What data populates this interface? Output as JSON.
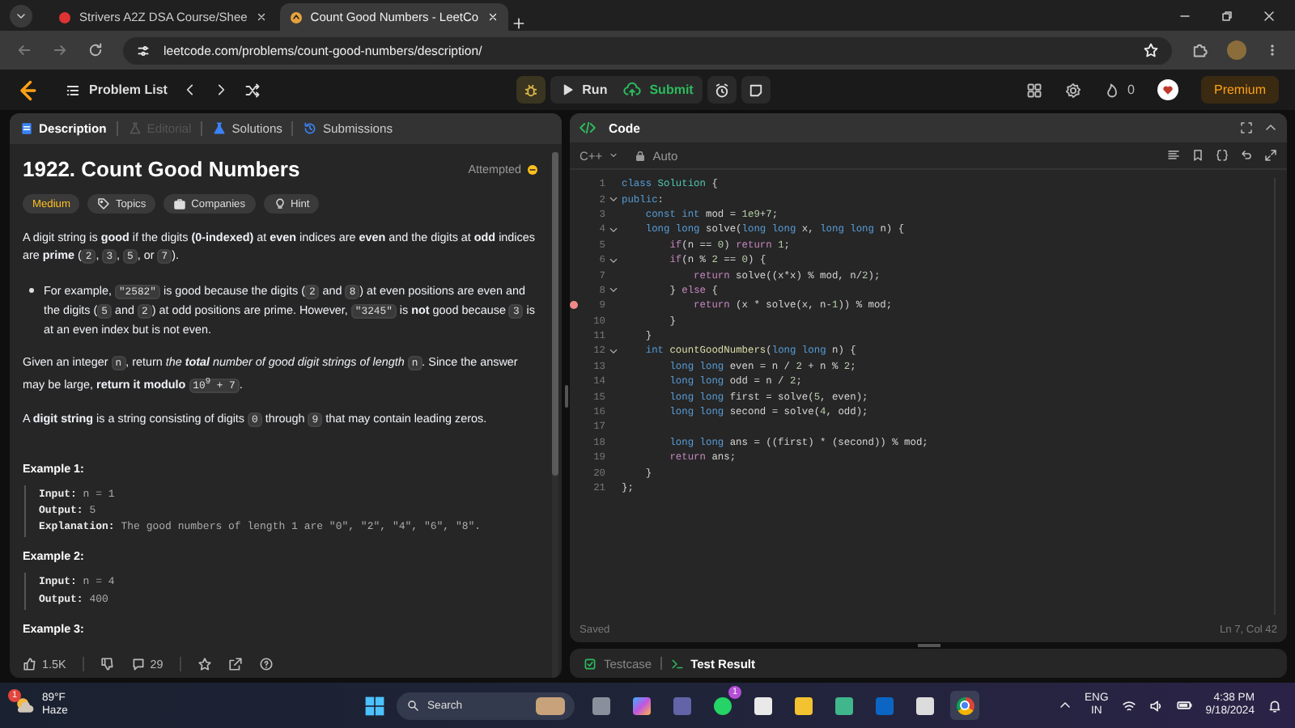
{
  "browser": {
    "tabs": [
      {
        "title": "Strivers A2Z DSA Course/Shee",
        "selected": false
      },
      {
        "title": "Count Good Numbers - LeetCo",
        "selected": true
      }
    ],
    "url": "leetcode.com/problems/count-good-numbers/description/"
  },
  "nav": {
    "problem_list": "Problem List",
    "run": "Run",
    "submit": "Submit",
    "streak": "0",
    "premium": "Premium"
  },
  "description": {
    "tabs": [
      {
        "label": "Description",
        "selected": true,
        "disabled": false
      },
      {
        "label": "Editorial",
        "selected": false,
        "disabled": true
      },
      {
        "label": "Solutions",
        "selected": false,
        "disabled": false
      },
      {
        "label": "Submissions",
        "selected": false,
        "disabled": false
      }
    ],
    "title": "1922. Count Good Numbers",
    "status": "Attempted",
    "tags": [
      {
        "kind": "difficulty",
        "label": "Medium"
      },
      {
        "kind": "topics",
        "label": "Topics"
      },
      {
        "kind": "companies",
        "label": "Companies"
      },
      {
        "kind": "hint",
        "label": "Hint"
      }
    ],
    "paragraphs": [
      {
        "kind": "text",
        "segments": [
          {
            "kind": "text",
            "text": "A digit string is **good** if the digits **(0-indexed)** at **even** indices are **even** and the digits at **odd** indices are **prime** ("
          },
          {
            "kind": "code",
            "text": "2"
          },
          {
            "kind": "text",
            "text": ", "
          },
          {
            "kind": "code",
            "text": "3"
          },
          {
            "kind": "text",
            "text": ", "
          },
          {
            "kind": "code",
            "text": "5"
          },
          {
            "kind": "text",
            "text": ", or "
          },
          {
            "kind": "code",
            "text": "7"
          },
          {
            "kind": "text",
            "text": ")."
          }
        ]
      },
      {
        "kind": "bullet",
        "segments": [
          {
            "kind": "text",
            "text": "For example, "
          },
          {
            "kind": "code",
            "text": "\"2582\""
          },
          {
            "kind": "text",
            "text": " is good because the digits ("
          },
          {
            "kind": "code",
            "text": "2"
          },
          {
            "kind": "text",
            "text": " and "
          },
          {
            "kind": "code",
            "text": "8"
          },
          {
            "kind": "text",
            "text": ") at even positions are even and the digits ("
          },
          {
            "kind": "code",
            "text": "5"
          },
          {
            "kind": "text",
            "text": " and "
          },
          {
            "kind": "code",
            "text": "2"
          },
          {
            "kind": "text",
            "text": ") at odd positions are prime. However, "
          },
          {
            "kind": "code",
            "text": "\"3245\""
          },
          {
            "kind": "text",
            "text": " is **not** good because "
          },
          {
            "kind": "code",
            "text": "3"
          },
          {
            "kind": "text",
            "text": " is at an even index but is not even."
          }
        ]
      },
      {
        "kind": "text",
        "segments": [
          {
            "kind": "text",
            "text": "Given an integer "
          },
          {
            "kind": "code",
            "text": "n"
          },
          {
            "kind": "text",
            "text": ", return "
          },
          {
            "kind": "italic",
            "text": "the **total** number of good digit strings of length "
          },
          {
            "kind": "code",
            "text": "n"
          },
          {
            "kind": "text",
            "text": ". Since the answer may be large, **return it modulo** "
          },
          {
            "kind": "code",
            "text": "10$^{9}$ + 7"
          },
          {
            "kind": "text",
            "text": "."
          }
        ]
      },
      {
        "kind": "text",
        "segments": [
          {
            "kind": "text",
            "text": "A **digit string** is a string consisting of digits "
          },
          {
            "kind": "code",
            "text": "0"
          },
          {
            "kind": "text",
            "text": " through "
          },
          {
            "kind": "code",
            "text": "9"
          },
          {
            "kind": "text",
            "text": " that may contain leading zeros."
          }
        ]
      }
    ],
    "examples": [
      {
        "title": "Example 1:",
        "lines": [
          {
            "label": "Input:",
            "value": "n = 1"
          },
          {
            "label": "Output:",
            "value": "5"
          },
          {
            "label": "Explanation:",
            "value": "The good numbers of length 1 are \"0\", \"2\", \"4\", \"6\", \"8\"."
          }
        ]
      },
      {
        "title": "Example 2:",
        "lines": [
          {
            "label": "Input:",
            "value": "n = 4"
          },
          {
            "label": "Output:",
            "value": "400"
          }
        ]
      },
      {
        "title": "Example 3:"
      }
    ],
    "footer": {
      "likes": "1.5K",
      "comments": "29"
    }
  },
  "editor": {
    "title": "Code",
    "language": "C++",
    "mode": "Auto",
    "lines": [
      {
        "n": "1",
        "fold": false,
        "breakpoint": false,
        "tokens": [
          {
            "kind": "keyword",
            "text": "class "
          },
          {
            "kind": "type",
            "text": "Solution"
          },
          {
            "kind": "plain",
            "text": " {"
          }
        ]
      },
      {
        "n": "2",
        "fold": true,
        "breakpoint": false,
        "tokens": [
          {
            "kind": "keyword",
            "text": "public"
          },
          {
            "kind": "plain",
            "text": ":"
          }
        ]
      },
      {
        "n": "3",
        "fold": false,
        "breakpoint": false,
        "tokens": [
          {
            "kind": "keyword",
            "text": "    const int"
          },
          {
            "kind": "plain",
            "text": " mod = "
          },
          {
            "kind": "number",
            "text": "1e9"
          },
          {
            "kind": "plain",
            "text": "+"
          },
          {
            "kind": "number",
            "text": "7"
          },
          {
            "kind": "plain",
            "text": ";"
          }
        ]
      },
      {
        "n": "4",
        "fold": true,
        "breakpoint": false,
        "tokens": [
          {
            "kind": "keyword",
            "text": "    long long"
          },
          {
            "kind": "plain",
            "text": " solve("
          },
          {
            "kind": "keyword",
            "text": "long long"
          },
          {
            "kind": "plain",
            "text": " x, "
          },
          {
            "kind": "keyword",
            "text": "long long"
          },
          {
            "kind": "plain",
            "text": " n) {"
          }
        ]
      },
      {
        "n": "5",
        "fold": false,
        "breakpoint": false,
        "tokens": [
          {
            "kind": "control",
            "text": "        if"
          },
          {
            "kind": "plain",
            "text": "(n == "
          },
          {
            "kind": "number",
            "text": "0"
          },
          {
            "kind": "plain",
            "text": ") "
          },
          {
            "kind": "control",
            "text": "return "
          },
          {
            "kind": "number",
            "text": "1"
          },
          {
            "kind": "plain",
            "text": ";"
          }
        ]
      },
      {
        "n": "6",
        "fold": true,
        "breakpoint": false,
        "tokens": [
          {
            "kind": "control",
            "text": "        if"
          },
          {
            "kind": "plain",
            "text": "(n % "
          },
          {
            "kind": "number",
            "text": "2"
          },
          {
            "kind": "plain",
            "text": " == "
          },
          {
            "kind": "number",
            "text": "0"
          },
          {
            "kind": "plain",
            "text": ") {"
          }
        ]
      },
      {
        "n": "7",
        "fold": false,
        "breakpoint": false,
        "tokens": [
          {
            "kind": "control",
            "text": "            return"
          },
          {
            "kind": "plain",
            "text": " solve((x*x) % mod, n/"
          },
          {
            "kind": "number",
            "text": "2"
          },
          {
            "kind": "plain",
            "text": ");"
          }
        ]
      },
      {
        "n": "8",
        "fold": true,
        "breakpoint": false,
        "tokens": [
          {
            "kind": "plain",
            "text": "        } "
          },
          {
            "kind": "control",
            "text": "else"
          },
          {
            "kind": "plain",
            "text": " {"
          }
        ]
      },
      {
        "n": "9",
        "fold": false,
        "breakpoint": true,
        "tokens": [
          {
            "kind": "control",
            "text": "            return"
          },
          {
            "kind": "plain",
            "text": " (x * solve(x, n-"
          },
          {
            "kind": "number",
            "text": "1"
          },
          {
            "kind": "plain",
            "text": ")) % mod;"
          }
        ]
      },
      {
        "n": "10",
        "fold": false,
        "breakpoint": false,
        "tokens": [
          {
            "kind": "plain",
            "text": "        }"
          }
        ]
      },
      {
        "n": "11",
        "fold": false,
        "breakpoint": false,
        "tokens": [
          {
            "kind": "plain",
            "text": "    }"
          }
        ]
      },
      {
        "n": "12",
        "fold": true,
        "breakpoint": false,
        "tokens": [
          {
            "kind": "keyword",
            "text": "    int "
          },
          {
            "kind": "function",
            "text": "countGoodNumbers"
          },
          {
            "kind": "plain",
            "text": "("
          },
          {
            "kind": "keyword",
            "text": "long long"
          },
          {
            "kind": "plain",
            "text": " n) {"
          }
        ]
      },
      {
        "n": "13",
        "fold": false,
        "breakpoint": false,
        "tokens": [
          {
            "kind": "keyword",
            "text": "        long long"
          },
          {
            "kind": "plain",
            "text": " even = n / "
          },
          {
            "kind": "number",
            "text": "2"
          },
          {
            "kind": "plain",
            "text": " + n % "
          },
          {
            "kind": "number",
            "text": "2"
          },
          {
            "kind": "plain",
            "text": ";"
          }
        ]
      },
      {
        "n": "14",
        "fold": false,
        "breakpoint": false,
        "tokens": [
          {
            "kind": "keyword",
            "text": "        long long"
          },
          {
            "kind": "plain",
            "text": " odd = n / "
          },
          {
            "kind": "number",
            "text": "2"
          },
          {
            "kind": "plain",
            "text": ";"
          }
        ]
      },
      {
        "n": "15",
        "fold": false,
        "breakpoint": false,
        "tokens": [
          {
            "kind": "keyword",
            "text": "        long long"
          },
          {
            "kind": "plain",
            "text": " first = solve("
          },
          {
            "kind": "number",
            "text": "5"
          },
          {
            "kind": "plain",
            "text": ", even);"
          }
        ]
      },
      {
        "n": "16",
        "fold": false,
        "breakpoint": false,
        "tokens": [
          {
            "kind": "keyword",
            "text": "        long long"
          },
          {
            "kind": "plain",
            "text": " second = solve("
          },
          {
            "kind": "number",
            "text": "4"
          },
          {
            "kind": "plain",
            "text": ", odd);"
          }
        ]
      },
      {
        "n": "17",
        "fold": false,
        "breakpoint": false
      },
      {
        "n": "18",
        "fold": false,
        "breakpoint": false,
        "tokens": [
          {
            "kind": "keyword",
            "text": "        long long"
          },
          {
            "kind": "plain",
            "text": " ans = ((first) * (second)) % mod;"
          }
        ]
      },
      {
        "n": "19",
        "fold": false,
        "breakpoint": false,
        "tokens": [
          {
            "kind": "control",
            "text": "        return"
          },
          {
            "kind": "plain",
            "text": " ans;"
          }
        ]
      },
      {
        "n": "20",
        "fold": false,
        "breakpoint": false,
        "tokens": [
          {
            "kind": "plain",
            "text": "    }"
          }
        ]
      },
      {
        "n": "21",
        "fold": false,
        "breakpoint": false,
        "tokens": [
          {
            "kind": "plain",
            "text": "};"
          }
        ]
      }
    ],
    "status": "Saved",
    "cursor": "Ln 7, Col 42",
    "bottom_tabs": [
      {
        "label": "Testcase",
        "selected": false
      },
      {
        "label": "Test Result",
        "selected": true
      }
    ]
  },
  "taskbar": {
    "weather": {
      "temp": "89°F",
      "condition": "Haze",
      "badge": "1"
    },
    "search": "Search",
    "chat_badge": "1",
    "language": "ENG",
    "region": "IN",
    "time": "4:38 PM",
    "date": "9/18/2024"
  }
}
